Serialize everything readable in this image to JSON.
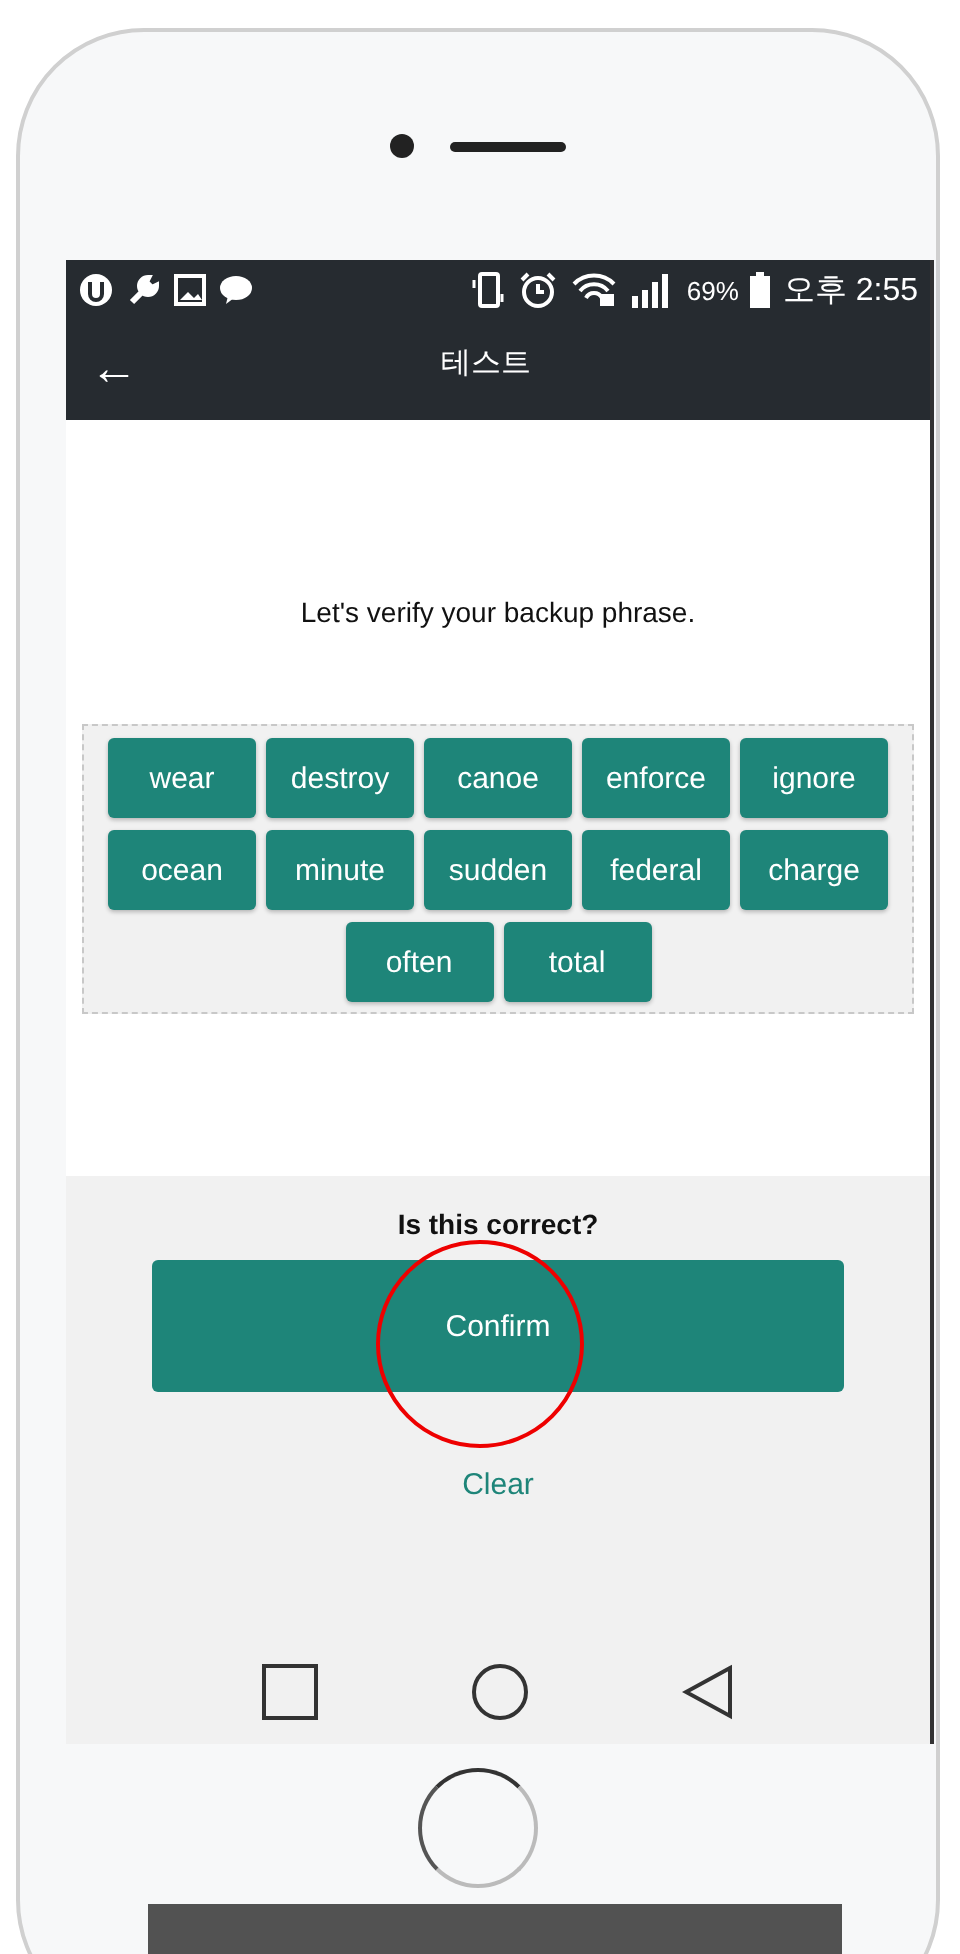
{
  "status_bar": {
    "battery": "69%",
    "time": "오후 2:55"
  },
  "app_bar": {
    "back": "←",
    "title": "테스트"
  },
  "prompt": "Let's verify your backup phrase.",
  "words": [
    "wear",
    "destroy",
    "canoe",
    "enforce",
    "ignore",
    "ocean",
    "minute",
    "sudden",
    "federal",
    "charge",
    "often",
    "total"
  ],
  "confirm_section": {
    "question": "Is this correct?",
    "confirm_button": "Confirm",
    "clear_link": "Clear"
  }
}
